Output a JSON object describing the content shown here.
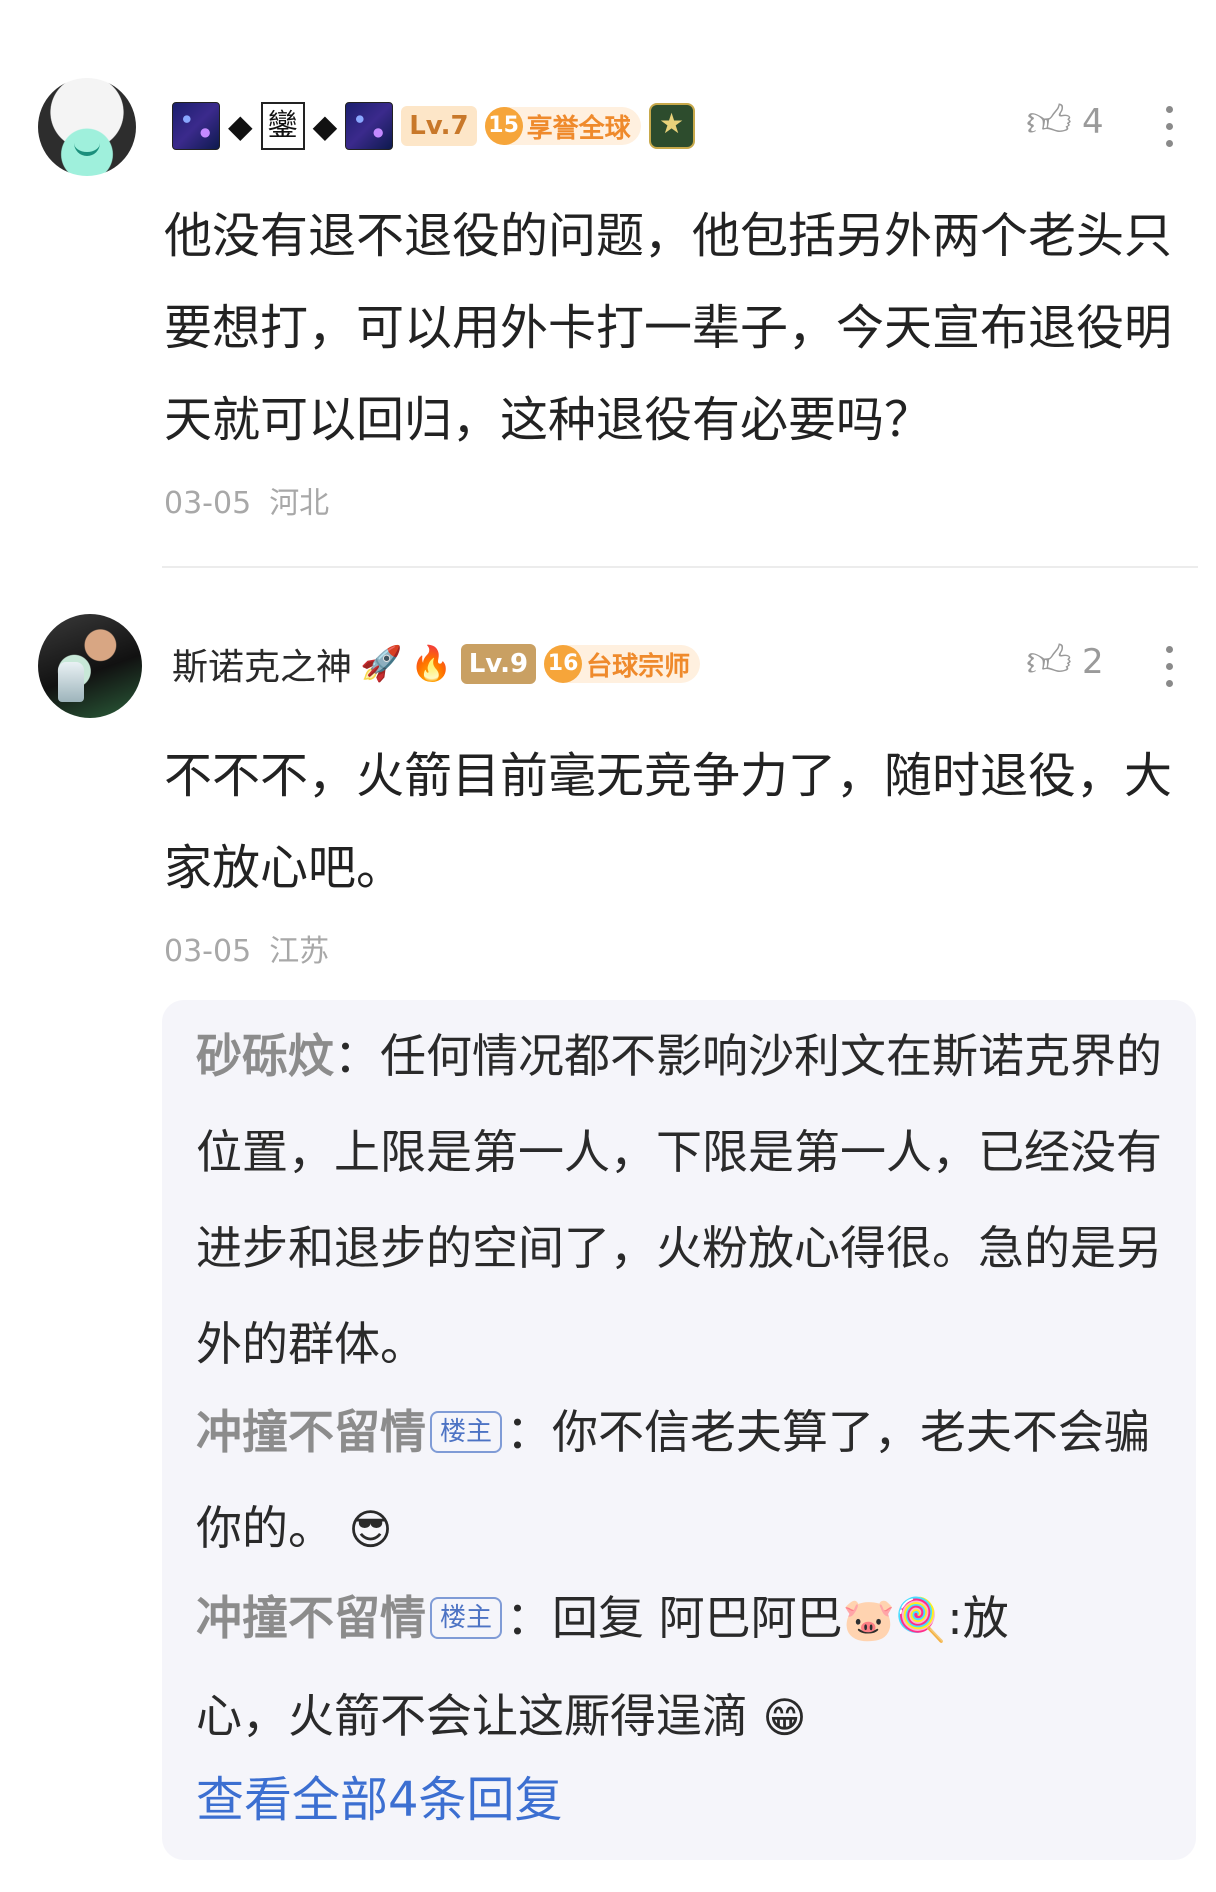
{
  "comments": [
    {
      "username_char": "鑾",
      "level": "Lv.7",
      "medal": {
        "number": "15",
        "label": "享誉全球"
      },
      "likes": "4",
      "text": "他没有退不退役的问题，他包括另外两个老头只要想打，可以用外卡打一辈子，今天宣布退役明天就可以回归，这种退役有必要吗？",
      "date": "03-05",
      "location": "河北"
    },
    {
      "username": "斯诺克之神",
      "username_emojis": [
        "🚀",
        "🔥"
      ],
      "level": "Lv.9",
      "medal": {
        "number": "16",
        "label": "台球宗师"
      },
      "likes": "2",
      "text": "不不不，火箭目前毫无竞争力了，随时退役，大家放心吧。",
      "date": "03-05",
      "location": "江苏"
    }
  ],
  "replies": [
    {
      "name": "砂砾炆",
      "text": "任何情况都不影响沙利文在斯诺克界的位置，上限是第一人，下限是第一人，已经没有进步和退步的空间了，火粉放心得很。急的是另外的群体。"
    },
    {
      "name": "冲撞不留情",
      "badge": "楼主",
      "text": "你不信老夫算了，老夫不会骗你的。",
      "emoji": "😎"
    },
    {
      "name": "冲撞不留情",
      "badge": "楼主",
      "reply_prefix": "回复 ",
      "reply_to": "阿巴阿巴",
      "reply_to_emojis": "🐷🍭",
      "text_a": ":放",
      "text_b": "心，火箭不会让这厮得逞滴",
      "emoji": "😁"
    }
  ],
  "view_all": "查看全部4条回复",
  "icons": {
    "like": "thumbs-up-icon",
    "more": "more-vertical-icon"
  }
}
